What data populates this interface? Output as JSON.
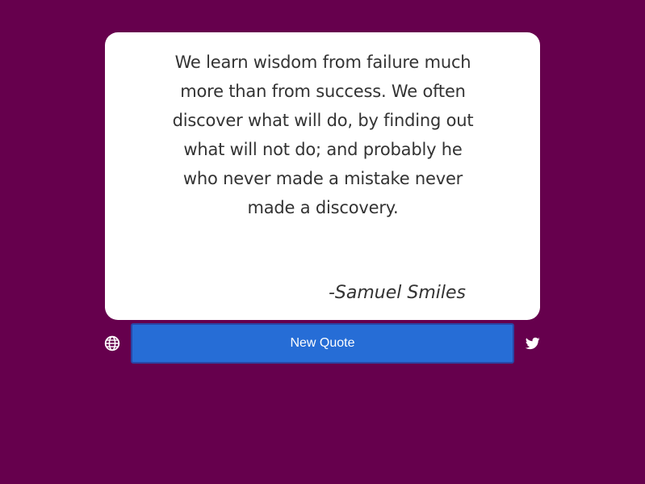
{
  "quote": {
    "text": "We learn wisdom from failure much more than from success. We often discover what will do, by finding out what will not do; and probably he who never made a mistake never made a discovery.",
    "author": "-Samuel Smiles"
  },
  "actions": {
    "new_quote_label": "New Quote",
    "left_icon": "globe-icon",
    "right_icon": "twitter-icon"
  },
  "colors": {
    "background": "#66004d",
    "card": "#ffffff",
    "button": "#266dd6",
    "button_border": "#2946a6",
    "text": "#333333"
  }
}
